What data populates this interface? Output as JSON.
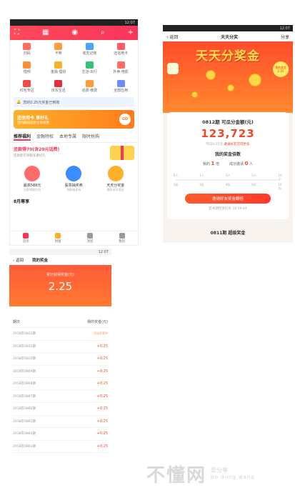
{
  "status_time": "12:07",
  "panel_home": {
    "row1": [
      {
        "label": "扫码",
        "color": "#ff6f61"
      },
      {
        "label": "卡券",
        "color": "#ff9b3a"
      },
      {
        "label": "收支记账",
        "color": "#4aa3ff"
      },
      {
        "label": "还信用卡",
        "color": "#ff5b6b"
      }
    ],
    "row2": [
      {
        "label": "借呗",
        "color": "#ff8f3a"
      },
      {
        "label": "金融·理财",
        "color": "#f7b42a"
      },
      {
        "label": "生活·出行",
        "color": "#36c27a"
      },
      {
        "label": "外卖·电影",
        "color": "#ff6f61"
      }
    ],
    "row3": [
      {
        "label": "红包专区",
        "color": "#f04a4a"
      },
      {
        "label": "京东生活",
        "color": "#e0303a"
      },
      {
        "label": "话费·缴费",
        "color": "#ff9b3a"
      },
      {
        "label": "全部应用",
        "color": "#6b8cff"
      }
    ],
    "notice": "您的0.25元奖金已到账",
    "banner": {
      "title": "还信用卡 享好礼",
      "subtitle": "活动期间还款立享优惠",
      "go": "GO"
    },
    "tabs": [
      "推荐福利",
      "金融特权",
      "本地专属",
      "限时抢购"
    ],
    "promo": {
      "title": "还款得70(含20元话费)",
      "subtitle": "还款即可领取多重好礼"
    },
    "features": [
      {
        "title": "最高588元",
        "subtitle": "立即领取红包",
        "color": "#ff6b6b"
      },
      {
        "title": "股票抽奖券",
        "subtitle": "领取抽奖券",
        "color": "#3a8dff"
      },
      {
        "title": "天天分奖金",
        "subtitle": "邀好友分奖金",
        "color": "#ffb02a"
      }
    ],
    "section_title": "8月尊享",
    "nav": [
      {
        "label": "首页",
        "color": "#f7355a"
      },
      {
        "label": "财富",
        "color": "#ffb02a"
      },
      {
        "label": "消息",
        "color": "#999999"
      },
      {
        "label": "我的",
        "color": "#999999"
      }
    ]
  },
  "panel_reward": {
    "back": "返回",
    "title": "天天分奖",
    "share": "分享",
    "hero_title": "天天分奖金",
    "badge": [
      "我的奖金",
      "2.25"
    ],
    "period": "0812期 可瓜分金额(元)",
    "amount": "123,723",
    "sub_prefix": "昨日0.25元",
    "sub_highlight": "邀请好友可得更多",
    "multiplier_title": "我的奖金倍数",
    "my_label": "我的",
    "my_value": "1",
    "my_unit": "倍",
    "friends_label": "成功邀请",
    "friends_value": "0",
    "friends_unit": "人",
    "scale": [
      {
        "people": "0人",
        "mult": "1倍"
      },
      {
        "people": "1人",
        "mult": "2倍"
      },
      {
        "people": "3人",
        "mult": "4倍"
      },
      {
        "people": "5人",
        "mult": "6倍"
      },
      {
        "people": "10人",
        "mult": "10倍"
      }
    ],
    "invite_button": "邀请好友奖金翻倍",
    "countdown": "距本期结束仍有 20:59:04",
    "footer": "0811期 超级奖金"
  },
  "panel_my_bonus": {
    "back": "返回",
    "title": "我的奖金",
    "hero_label": "累计获得奖金(元)",
    "hero_value": "2.25",
    "col_left": "期次",
    "col_right": "我的奖金(元)",
    "rows": [
      {
        "period": "2018年0812期",
        "value": "活动开奖中"
      },
      {
        "period": "2018年0811期",
        "value": "+0.25"
      },
      {
        "period": "2018年0810期",
        "value": "+0.25"
      },
      {
        "period": "2018年0809期",
        "value": "+0.25"
      },
      {
        "period": "2018年0808期",
        "value": "+0.25"
      },
      {
        "period": "2018年0807期",
        "value": "+0.25"
      },
      {
        "period": "2018年0806期",
        "value": "+0.25"
      },
      {
        "period": "2018年0805期",
        "value": "+0.25"
      },
      {
        "period": "2018年0804期",
        "value": "+0.25"
      },
      {
        "period": "2018年0803期",
        "value": "+0.25"
      }
    ]
  },
  "watermark": {
    "main": "不懂网",
    "side": "爱分享",
    "pinyin": "bu dong wang"
  }
}
